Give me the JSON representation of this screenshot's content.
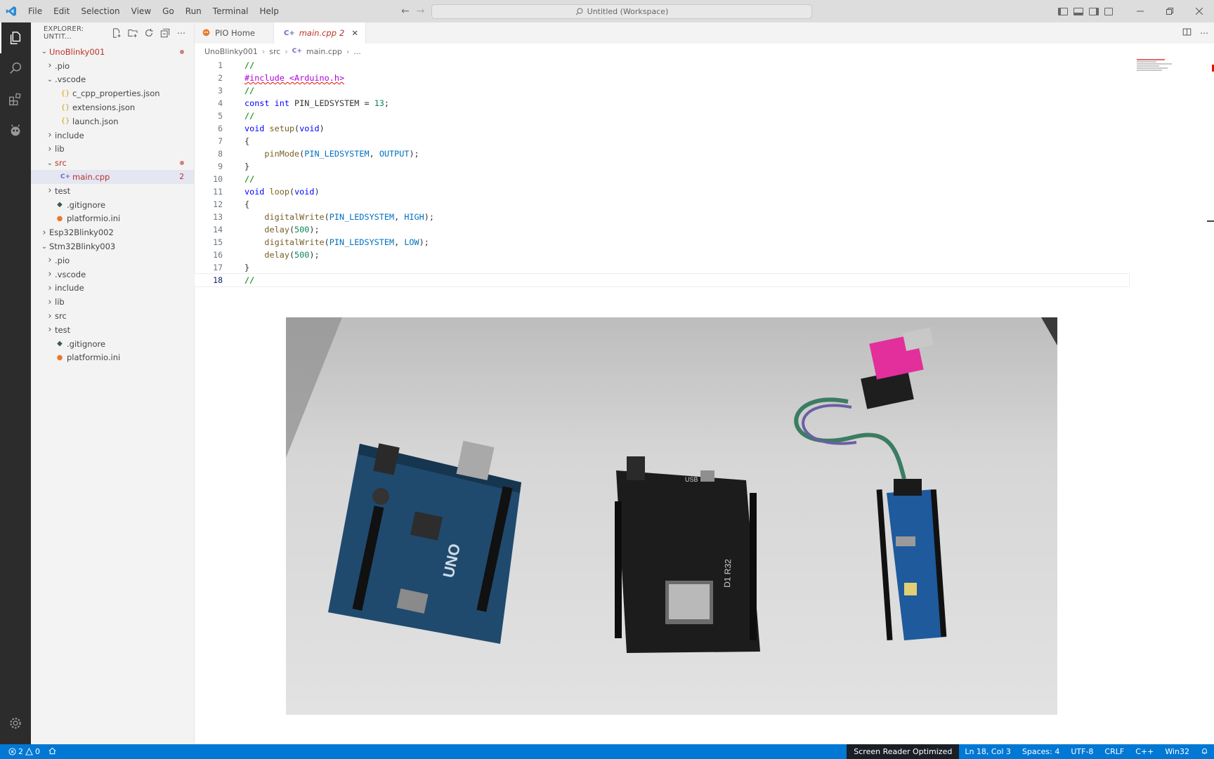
{
  "menu": [
    "File",
    "Edit",
    "Selection",
    "View",
    "Go",
    "Run",
    "Terminal",
    "Help"
  ],
  "command_center": {
    "label": "Untitled (Workspace)"
  },
  "explorer": {
    "title": "EXPLORER: UNTIT...",
    "tree": [
      {
        "label": "UnoBlinky001",
        "depth": 0,
        "kind": "folder-open",
        "modified": true,
        "dot": true
      },
      {
        "label": ".pio",
        "depth": 1,
        "kind": "folder"
      },
      {
        "label": ".vscode",
        "depth": 1,
        "kind": "folder-open"
      },
      {
        "label": "c_cpp_properties.json",
        "depth": 2,
        "kind": "json"
      },
      {
        "label": "extensions.json",
        "depth": 2,
        "kind": "json"
      },
      {
        "label": "launch.json",
        "depth": 2,
        "kind": "json"
      },
      {
        "label": "include",
        "depth": 1,
        "kind": "folder"
      },
      {
        "label": "lib",
        "depth": 1,
        "kind": "folder"
      },
      {
        "label": "src",
        "depth": 1,
        "kind": "folder-open",
        "modified": true,
        "dot": true
      },
      {
        "label": "main.cpp",
        "depth": 2,
        "kind": "cpp",
        "modified": true,
        "selected": true,
        "count": "2"
      },
      {
        "label": "test",
        "depth": 1,
        "kind": "folder"
      },
      {
        "label": ".gitignore",
        "depth": 1,
        "kind": "git"
      },
      {
        "label": "platformio.ini",
        "depth": 1,
        "kind": "pio"
      },
      {
        "label": "Esp32Blinky002",
        "depth": 0,
        "kind": "folder"
      },
      {
        "label": "Stm32Blinky003",
        "depth": 0,
        "kind": "folder-open"
      },
      {
        "label": ".pio",
        "depth": 1,
        "kind": "folder"
      },
      {
        "label": ".vscode",
        "depth": 1,
        "kind": "folder"
      },
      {
        "label": "include",
        "depth": 1,
        "kind": "folder"
      },
      {
        "label": "lib",
        "depth": 1,
        "kind": "folder"
      },
      {
        "label": "src",
        "depth": 1,
        "kind": "folder"
      },
      {
        "label": "test",
        "depth": 1,
        "kind": "folder"
      },
      {
        "label": ".gitignore",
        "depth": 1,
        "kind": "git"
      },
      {
        "label": "platformio.ini",
        "depth": 1,
        "kind": "pio"
      }
    ]
  },
  "tabs": [
    {
      "label": "PIO Home",
      "active": false
    },
    {
      "label": "main.cpp",
      "count": "2",
      "active": true
    }
  ],
  "breadcrumb": [
    "UnoBlinky001",
    "src",
    "main.cpp",
    "..."
  ],
  "code": [
    [
      [
        "cmt",
        "//"
      ]
    ],
    [
      [
        "pp-err",
        "#include <Arduino.h>"
      ]
    ],
    [
      [
        "cmt",
        "//"
      ]
    ],
    [
      [
        "kw",
        "const"
      ],
      [
        "",
        " "
      ],
      [
        "kw",
        "int"
      ],
      [
        "",
        " PIN_LEDSYSTEM = "
      ],
      [
        "num",
        "13"
      ],
      [
        "",
        ";"
      ]
    ],
    [
      [
        "cmt",
        "//"
      ]
    ],
    [
      [
        "kw",
        "void"
      ],
      [
        "",
        " "
      ],
      [
        "fn",
        "setup"
      ],
      [
        "",
        "("
      ],
      [
        "kw",
        "void"
      ],
      [
        "",
        ")"
      ]
    ],
    [
      [
        "",
        "{"
      ]
    ],
    [
      [
        "",
        "    "
      ],
      [
        "fn",
        "pinMode"
      ],
      [
        "",
        "("
      ],
      [
        "const",
        "PIN_LEDSYSTEM"
      ],
      [
        "",
        ", "
      ],
      [
        "const",
        "OUTPUT"
      ],
      [
        "",
        ");"
      ]
    ],
    [
      [
        "",
        "}"
      ]
    ],
    [
      [
        "cmt",
        "//"
      ]
    ],
    [
      [
        "kw",
        "void"
      ],
      [
        "",
        " "
      ],
      [
        "fn",
        "loop"
      ],
      [
        "",
        "("
      ],
      [
        "kw",
        "void"
      ],
      [
        "",
        ")"
      ]
    ],
    [
      [
        "",
        "{"
      ]
    ],
    [
      [
        "",
        "    "
      ],
      [
        "fn",
        "digitalWrite"
      ],
      [
        "",
        "("
      ],
      [
        "const",
        "PIN_LEDSYSTEM"
      ],
      [
        "",
        ", "
      ],
      [
        "const",
        "HIGH"
      ],
      [
        "",
        ");"
      ]
    ],
    [
      [
        "",
        "    "
      ],
      [
        "fn",
        "delay"
      ],
      [
        "",
        "("
      ],
      [
        "num",
        "500"
      ],
      [
        "",
        ");"
      ]
    ],
    [
      [
        "",
        "    "
      ],
      [
        "fn",
        "digitalWrite"
      ],
      [
        "",
        "("
      ],
      [
        "const",
        "PIN_LEDSYSTEM"
      ],
      [
        "",
        ", "
      ],
      [
        "const",
        "LOW"
      ],
      [
        "",
        ");"
      ]
    ],
    [
      [
        "",
        "    "
      ],
      [
        "fn",
        "delay"
      ],
      [
        "",
        "("
      ],
      [
        "num",
        "500"
      ],
      [
        "",
        ");"
      ]
    ],
    [
      [
        "",
        "}"
      ]
    ],
    [
      [
        "cmt",
        "//"
      ]
    ]
  ],
  "current_line": 18,
  "photo": {
    "board_labels": [
      "UNO",
      "USB",
      "D1 R32"
    ]
  },
  "statusbar": {
    "errors": "2",
    "warnings": "0",
    "screen_reader": "Screen Reader Optimized",
    "position": "Ln 18, Col 3",
    "spaces": "Spaces: 4",
    "encoding": "UTF-8",
    "eol": "CRLF",
    "language": "C++",
    "platform": "Win32"
  },
  "colors": {
    "statusbar_bg": "#0078d4",
    "activitybar_bg": "#2c2c2c",
    "sidebar_bg": "#f3f3f3",
    "modified": "#b6352d"
  }
}
